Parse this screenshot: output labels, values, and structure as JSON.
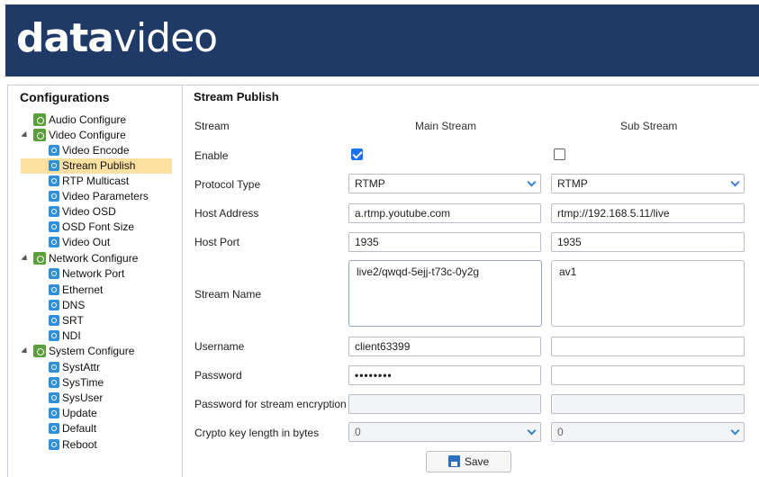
{
  "header": {
    "logo_bold": "data",
    "logo_light": "video"
  },
  "sidebar": {
    "title": "Configurations",
    "items": [
      {
        "label": "Audio Configure",
        "level": 1,
        "group": true
      },
      {
        "label": "Video Configure",
        "level": 1,
        "group": true,
        "expanded": true
      },
      {
        "label": "Video Encode",
        "level": 2
      },
      {
        "label": "Stream Publish",
        "level": 2,
        "selected": true
      },
      {
        "label": "RTP Multicast",
        "level": 2
      },
      {
        "label": "Video Parameters",
        "level": 2
      },
      {
        "label": "Video OSD",
        "level": 2
      },
      {
        "label": "OSD Font Size",
        "level": 2
      },
      {
        "label": "Video Out",
        "level": 2
      },
      {
        "label": "Network Configure",
        "level": 1,
        "group": true,
        "expanded": true
      },
      {
        "label": "Network Port",
        "level": 2
      },
      {
        "label": "Ethernet",
        "level": 2
      },
      {
        "label": "DNS",
        "level": 2
      },
      {
        "label": "SRT",
        "level": 2
      },
      {
        "label": "NDI",
        "level": 2
      },
      {
        "label": "System Configure",
        "level": 1,
        "group": true,
        "expanded": true
      },
      {
        "label": "SystAttr",
        "level": 2
      },
      {
        "label": "SysTime",
        "level": 2
      },
      {
        "label": "SysUser",
        "level": 2
      },
      {
        "label": "Update",
        "level": 2
      },
      {
        "label": "Default",
        "level": 2
      },
      {
        "label": "Reboot",
        "level": 2
      }
    ]
  },
  "main": {
    "title": "Stream Publish",
    "labels": {
      "stream": "Stream",
      "enable": "Enable",
      "protocol": "Protocol Type",
      "host": "Host Address",
      "port": "Host Port",
      "name": "Stream Name",
      "username": "Username",
      "password": "Password",
      "encpass": "Password for stream encryption",
      "crypto": "Crypto key length in bytes"
    },
    "main_stream": {
      "header": "Main Stream",
      "enabled": true,
      "protocol": "RTMP",
      "host": "a.rtmp.youtube.com",
      "port": "1935",
      "name": "live2/qwqd-5ejj-t73c-0y2g",
      "username": "client63399",
      "password": "••••••••",
      "encpass": "",
      "crypto": "0"
    },
    "sub_stream": {
      "header": "Sub Stream",
      "enabled": false,
      "protocol": "RTMP",
      "host": "rtmp://192.168.5.11/live",
      "port": "1935",
      "name": "av1",
      "username": "",
      "password": "",
      "encpass": "",
      "crypto": "0"
    },
    "save_label": "Save"
  },
  "colors": {
    "header_bg": "#1f3a66",
    "selected_bg": "#fbe0a0",
    "accent": "#1a73e8"
  }
}
